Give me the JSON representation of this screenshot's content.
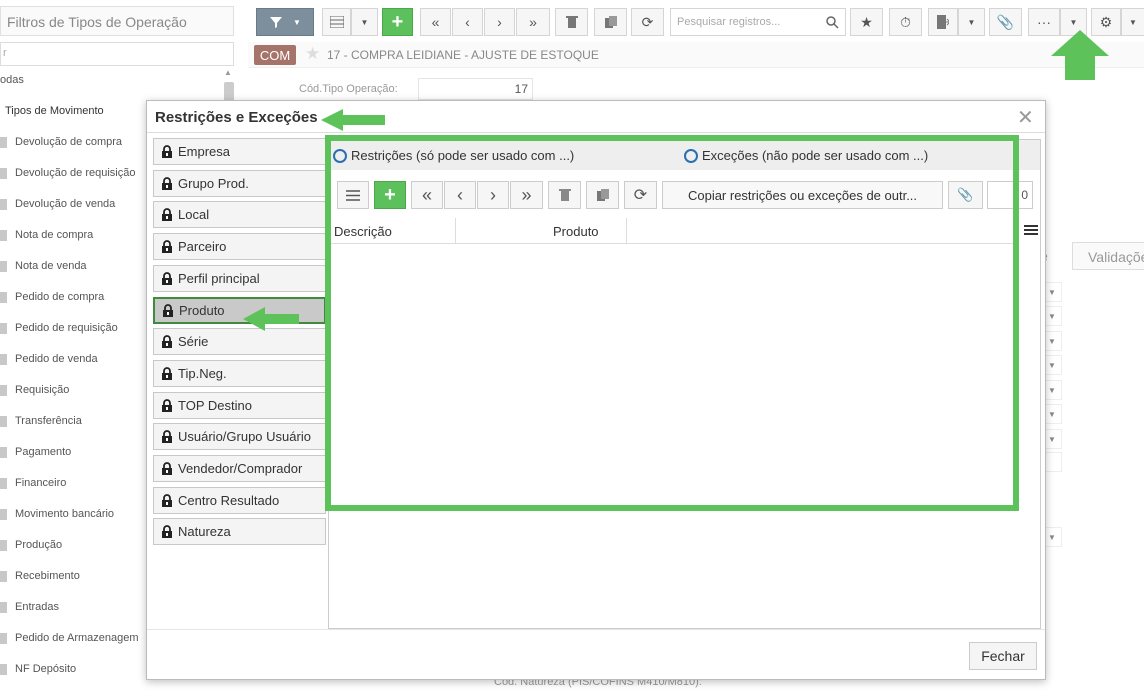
{
  "left": {
    "filter_title": "Filtros de Tipos de Operação",
    "search_placeholder": "r",
    "all_label": "odas",
    "group_label": "Tipos de Movimento",
    "items": [
      "Devolução de compra",
      "Devolução de requisição",
      "Devolução de venda",
      "Nota de compra",
      "Nota de venda",
      "Pedido de compra",
      "Pedido de requisição",
      "Pedido de venda",
      "Requisição",
      "Transferência",
      "Pagamento",
      "Financeiro",
      "Movimento bancário",
      "Produção",
      "Recebimento",
      "Entradas",
      "Pedido de Armazenagem",
      "NF Depósito"
    ]
  },
  "toolbar": {
    "search_placeholder": "Pesquisar registros..."
  },
  "record": {
    "badge": "COM",
    "title": "17 - COMPRA LEIDIANE - AJUSTE DE ESTOQUE",
    "cod_label": "Cód.Tipo Operação:",
    "cod_value": "17"
  },
  "background": {
    "tab_partial": "e",
    "tab_validacoes": "Validaçõe",
    "bottom_label": "Cód. Natureza (PIS/COFINS M410/M810):"
  },
  "modal": {
    "title": "Restrições e Exceções",
    "categories": [
      "Empresa",
      "Grupo Prod.",
      "Local",
      "Parceiro",
      "Perfil principal",
      "Produto",
      "Série",
      "Tip.Neg.",
      "TOP Destino",
      "Usuário/Grupo Usuário",
      "Vendedor/Comprador",
      "Centro Resultado",
      "Natureza"
    ],
    "active_category": "Produto",
    "radio_restricoes": "Restrições (só pode ser usado com ...)",
    "radio_excecoes": "Exceções (não pode ser usado com ...)",
    "copy_button": "Copiar restrições ou exceções de outr...",
    "count_value": "0",
    "columns": [
      "Descrição",
      "Produto"
    ],
    "close_button": "Fechar"
  },
  "colors": {
    "accent_green": "#5dc25a",
    "badge_brown": "#a6736a",
    "filter_grey": "#7d8f9c",
    "radio_blue": "#2a6fb0"
  }
}
